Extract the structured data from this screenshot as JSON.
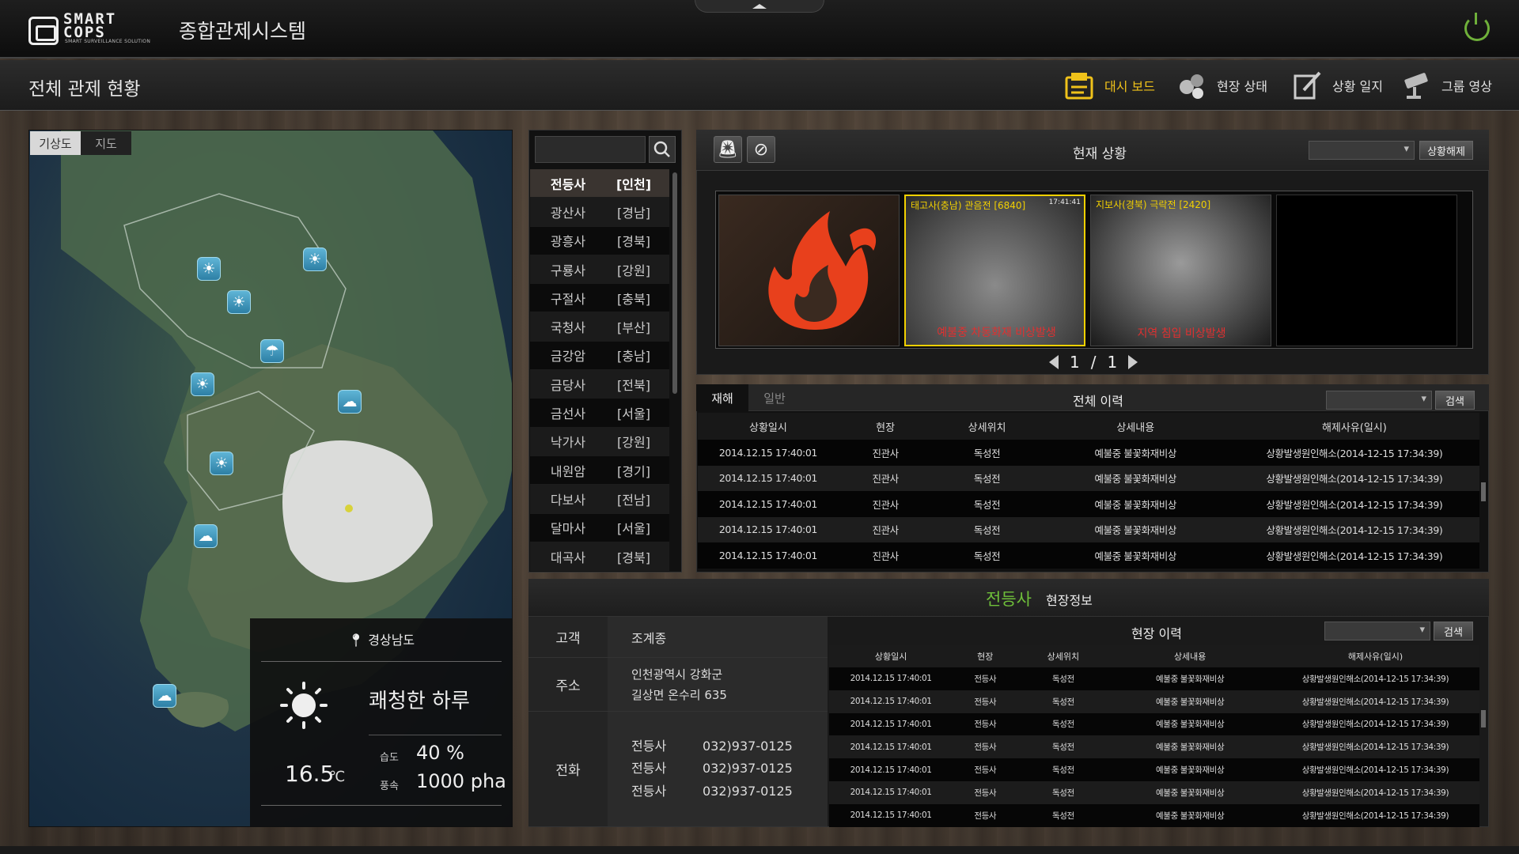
{
  "app": {
    "logo_text_1": "SMART",
    "logo_text_2": "COPS",
    "logo_sub": "SMART SURVEILLANCE SOLUTION",
    "title": "종합관제시스템"
  },
  "page": {
    "title": "전체 관제 현황"
  },
  "nav": [
    {
      "label": "대시 보드",
      "icon": "dashboard-icon",
      "active": true
    },
    {
      "label": "현장 상태",
      "icon": "site-status-icon"
    },
    {
      "label": "상황 일지",
      "icon": "log-icon"
    },
    {
      "label": "그룹 영상",
      "icon": "cctv-icon"
    }
  ],
  "map": {
    "tabs": [
      "기상도",
      "지도"
    ],
    "weather": {
      "location": "경상남도",
      "description": "쾌청한 하루",
      "temperature": "16.5",
      "temp_unit": "℃",
      "humidity_label": "습도",
      "humidity": "40 %",
      "wind_label": "풍속",
      "wind": "1000 pha"
    }
  },
  "site_list": [
    {
      "name": "전등사",
      "region": "[인천]",
      "selected": true
    },
    {
      "name": "광산사",
      "region": "[경남]"
    },
    {
      "name": "광흥사",
      "region": "[경북]"
    },
    {
      "name": "구룡사",
      "region": "[강원]"
    },
    {
      "name": "구절사",
      "region": "[충북]"
    },
    {
      "name": "국청사",
      "region": "[부산]"
    },
    {
      "name": "금강암",
      "region": "[충남]"
    },
    {
      "name": "금당사",
      "region": "[전북]"
    },
    {
      "name": "금선사",
      "region": "[서울]"
    },
    {
      "name": "낙가사",
      "region": "[강원]"
    },
    {
      "name": "내원암",
      "region": "[경기]"
    },
    {
      "name": "다보사",
      "region": "[전남]"
    },
    {
      "name": "달마사",
      "region": "[서울]"
    },
    {
      "name": "대곡사",
      "region": "[경북]"
    }
  ],
  "current": {
    "title": "현재 상황",
    "release_button": "상황해제",
    "cameras": [
      {
        "caption": "",
        "alarm": ""
      },
      {
        "caption": "태고사(충남) 관음전 [6840]",
        "time": "17:41:41",
        "alarm": "예불중 차동화재 비상발생"
      },
      {
        "caption": "지보사(경북) 극락전 [2420]",
        "alarm": "지역 침입 비상발생"
      }
    ],
    "page_current": "1",
    "page_sep": "/",
    "page_total": "1"
  },
  "history": {
    "tabs": [
      "재해",
      "일반"
    ],
    "title": "전체 이력",
    "search_button": "검색",
    "columns": [
      "상황일시",
      "현장",
      "상세위치",
      "상세내용",
      "해제사유(일시)"
    ],
    "rows": [
      [
        "2014.12.15 17:40:01",
        "진관사",
        "독성전",
        "예불중  불꽃화재비상",
        "상황발생원인해소(2014-12-15 17:34:39)"
      ],
      [
        "2014.12.15 17:40:01",
        "진관사",
        "독성전",
        "예불중  불꽃화재비상",
        "상황발생원인해소(2014-12-15 17:34:39)"
      ],
      [
        "2014.12.15 17:40:01",
        "진관사",
        "독성전",
        "예불중  불꽃화재비상",
        "상황발생원인해소(2014-12-15 17:34:39)"
      ],
      [
        "2014.12.15 17:40:01",
        "진관사",
        "독성전",
        "예불중  불꽃화재비상",
        "상황발생원인해소(2014-12-15 17:34:39)"
      ],
      [
        "2014.12.15 17:40:01",
        "진관사",
        "독성전",
        "예불중  불꽃화재비상",
        "상황발생원인해소(2014-12-15 17:34:39)"
      ]
    ]
  },
  "site_info": {
    "site_name": "전등사",
    "subtitle": "현장정보",
    "customer_label": "고객",
    "customer": "조계종",
    "address_label": "주소",
    "address_line1": "인천광역시 강화군",
    "address_line2": "길상면 온수리 635",
    "phone_label": "전화",
    "phones": [
      {
        "name": "전등사",
        "number": "032)937-0125"
      },
      {
        "name": "전등사",
        "number": "032)937-0125"
      },
      {
        "name": "전등사",
        "number": "032)937-0125"
      }
    ],
    "history_title": "현장 이력",
    "search_button": "검색",
    "columns": [
      "상황일시",
      "현장",
      "상세위치",
      "상세내용",
      "해제사유(일시)"
    ],
    "rows": [
      [
        "2014.12.15 17:40:01",
        "전등사",
        "독성전",
        "예불중  불꽃화재비상",
        "상황발생원인해소(2014-12-15 17:34:39)"
      ],
      [
        "2014.12.15 17:40:01",
        "전등사",
        "독성전",
        "예불중  불꽃화재비상",
        "상황발생원인해소(2014-12-15 17:34:39)"
      ],
      [
        "2014.12.15 17:40:01",
        "전등사",
        "독성전",
        "예불중  불꽃화재비상",
        "상황발생원인해소(2014-12-15 17:34:39)"
      ],
      [
        "2014.12.15 17:40:01",
        "전등사",
        "독성전",
        "예불중  불꽃화재비상",
        "상황발생원인해소(2014-12-15 17:34:39)"
      ],
      [
        "2014.12.15 17:40:01",
        "전등사",
        "독성전",
        "예불중  불꽃화재비상",
        "상황발생원인해소(2014-12-15 17:34:39)"
      ],
      [
        "2014.12.15 17:40:01",
        "전등사",
        "독성전",
        "예불중  불꽃화재비상",
        "상황발생원인해소(2014-12-15 17:34:39)"
      ],
      [
        "2014.12.15 17:40:01",
        "전등사",
        "독성전",
        "예불중  불꽃화재비상",
        "상황발생원인해소(2014-12-15 17:34:39)"
      ]
    ]
  },
  "colors": {
    "accent": "#f0c21a",
    "site_name": "#6fbf3a",
    "alarm": "#e03030",
    "camera_caption": "#f2d000",
    "power": "#6fb03a"
  }
}
